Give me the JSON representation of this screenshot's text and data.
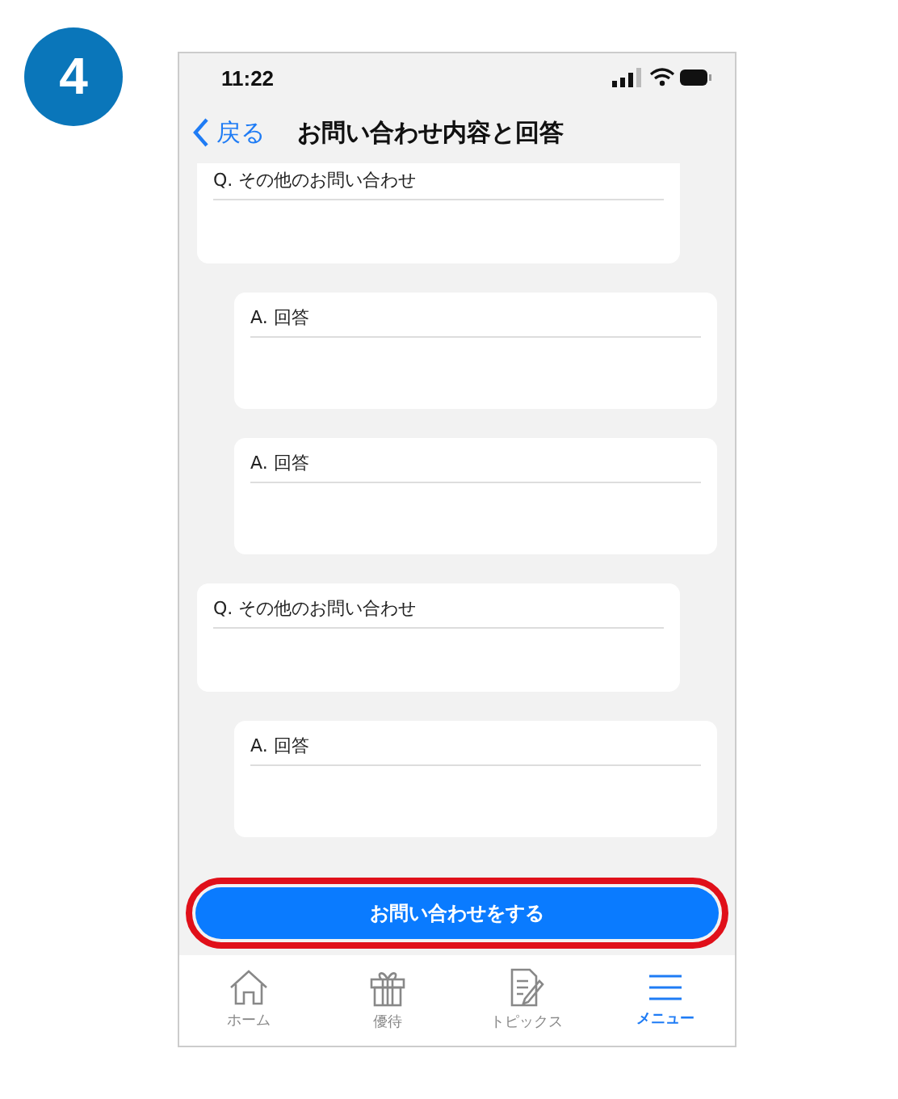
{
  "step_badge": "4",
  "status_bar": {
    "time": "11:22"
  },
  "nav": {
    "back": "戻る",
    "title": "お問い合わせ内容と回答"
  },
  "messages": [
    {
      "kind": "question",
      "label": "Q. その他のお問い合わせ"
    },
    {
      "kind": "answer",
      "label": "A. 回答"
    },
    {
      "kind": "answer",
      "label": "A. 回答"
    },
    {
      "kind": "question",
      "label": "Q. その他のお問い合わせ"
    },
    {
      "kind": "answer",
      "label": "A. 回答"
    }
  ],
  "action_button": {
    "label": "お問い合わせをする",
    "highlighted": true
  },
  "tabs": [
    {
      "label": "ホーム",
      "selected": false
    },
    {
      "label": "優待",
      "selected": false
    },
    {
      "label": "トピックス",
      "selected": false
    },
    {
      "label": "メニュー",
      "selected": true
    }
  ]
}
